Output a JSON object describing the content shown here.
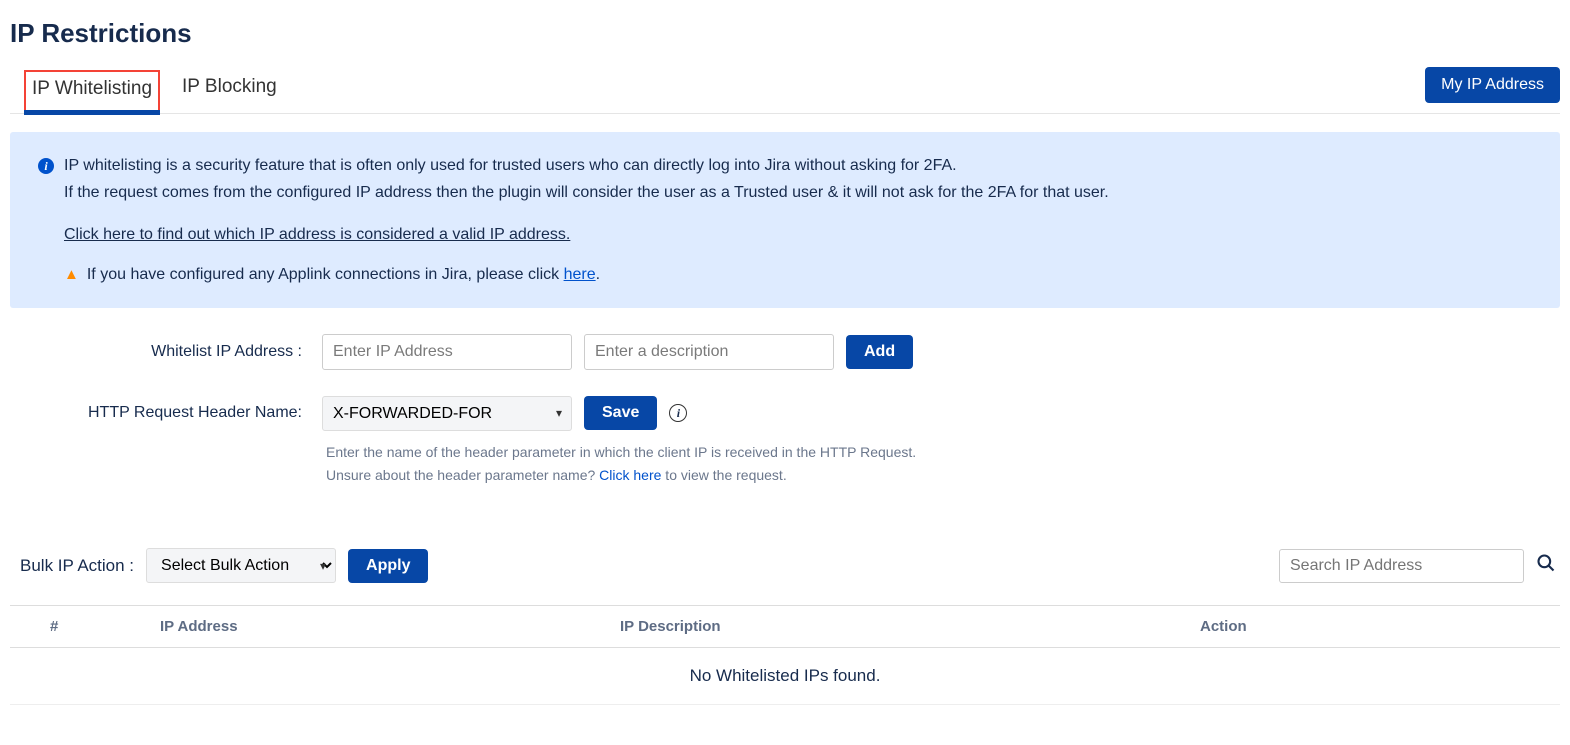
{
  "page": {
    "title": "IP Restrictions"
  },
  "tabs": {
    "whitelisting": "IP Whitelisting",
    "blocking": "IP Blocking"
  },
  "buttons": {
    "my_ip": "My IP Address",
    "add": "Add",
    "save": "Save",
    "apply": "Apply"
  },
  "info": {
    "line1": "IP whitelisting is a security feature that is often only used for trusted users who can directly log into Jira without asking for 2FA.",
    "line2": "If the request comes from the configured IP address then the plugin will consider the user as a Trusted user & it will not ask for the 2FA for that user.",
    "find_link": "Click here to find out which IP address is considered a valid IP address.",
    "warn_prefix": "If you have configured any Applink connections in Jira, please click ",
    "warn_link": "here",
    "warn_suffix": "."
  },
  "form": {
    "whitelist_label": "Whitelist IP Address :",
    "ip_placeholder": "Enter IP Address",
    "desc_placeholder": "Enter a description",
    "header_label": "HTTP Request Header Name:",
    "header_value": "X-FORWARDED-FOR",
    "help1": "Enter the name of the header parameter in which the client IP is received in the HTTP Request.",
    "help2_prefix": "Unsure about the header parameter name? ",
    "help2_link": "Click here",
    "help2_suffix": " to view the request."
  },
  "bulk": {
    "label": "Bulk IP Action :",
    "select_value": "Select Bulk Action"
  },
  "search": {
    "placeholder": "Search IP Address"
  },
  "table": {
    "col_num": "#",
    "col_ip": "IP Address",
    "col_desc": "IP Description",
    "col_action": "Action",
    "empty": "No Whitelisted IPs found."
  }
}
